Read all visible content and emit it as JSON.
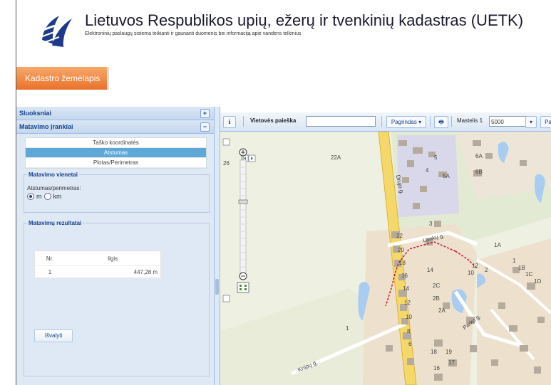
{
  "header": {
    "title": "Lietuvos Respublikos upių, ežerų ir tvenkinių kadastras (UETK)",
    "subtitle": "Elektroninių paslaugų sistema teikianti ir gaunanti duomenis bei informaciją apie vandens telkinius",
    "active_tab": "Kadastro žemėlapis"
  },
  "left_panel": {
    "layers_label": "Sluoksniai",
    "measure_label": "Matavimo įrankiai",
    "tools": [
      "Taško koordinatės",
      "Atstumas",
      "Plotas/Perimetras"
    ],
    "selected_tool": "Atstumas",
    "units_legend": "Matavimo vienetai",
    "units_label": "Atstumas/perimetras:",
    "unit_m": "m",
    "unit_km": "km",
    "selected_unit": "m",
    "results_legend": "Matavimų rezultatai",
    "results_headers": [
      "Nr.",
      "Ilgis"
    ],
    "results_rows": [
      {
        "nr": "1",
        "length": "447,28 m"
      }
    ],
    "clear_label": "Išvalyti"
  },
  "toolbar": {
    "search_label": "Vietovės paieška",
    "search_value": "",
    "base_select": "Pagrindas",
    "scale_label": "Mastelis 1",
    "scale_value": "5000",
    "more_select": "Pa"
  },
  "map": {
    "labels": [
      {
        "text": "26"
      },
      {
        "text": "22A"
      },
      {
        "text": "Drujo g."
      },
      {
        "text": "5A"
      },
      {
        "text": "6A"
      },
      {
        "text": "6B"
      },
      {
        "text": "5"
      },
      {
        "text": "4"
      },
      {
        "text": "3"
      },
      {
        "text": "Lankų g."
      },
      {
        "text": "22"
      },
      {
        "text": "20"
      },
      {
        "text": "18"
      },
      {
        "text": "16"
      },
      {
        "text": "14"
      },
      {
        "text": "12"
      },
      {
        "text": "10"
      },
      {
        "text": "8"
      },
      {
        "text": "6"
      },
      {
        "text": "1A"
      },
      {
        "text": "14"
      },
      {
        "text": "12"
      },
      {
        "text": "2"
      },
      {
        "text": "10"
      },
      {
        "text": "1"
      },
      {
        "text": "1B"
      },
      {
        "text": "1C"
      },
      {
        "text": "1D"
      },
      {
        "text": "2C"
      },
      {
        "text": "2B"
      },
      {
        "text": "2A"
      },
      {
        "text": "Parko g."
      },
      {
        "text": "1"
      },
      {
        "text": "18"
      },
      {
        "text": "19"
      },
      {
        "text": "16"
      },
      {
        "text": "17"
      },
      {
        "text": "Knipų g."
      }
    ]
  },
  "colors": {
    "accent_tab": "#e9712a",
    "panel_bg": "#dfe9f5",
    "selected_tool": "#5ea8d8",
    "road": "#f4d96a",
    "water": "#a8cdf0",
    "measure_line": "#c8102e"
  }
}
